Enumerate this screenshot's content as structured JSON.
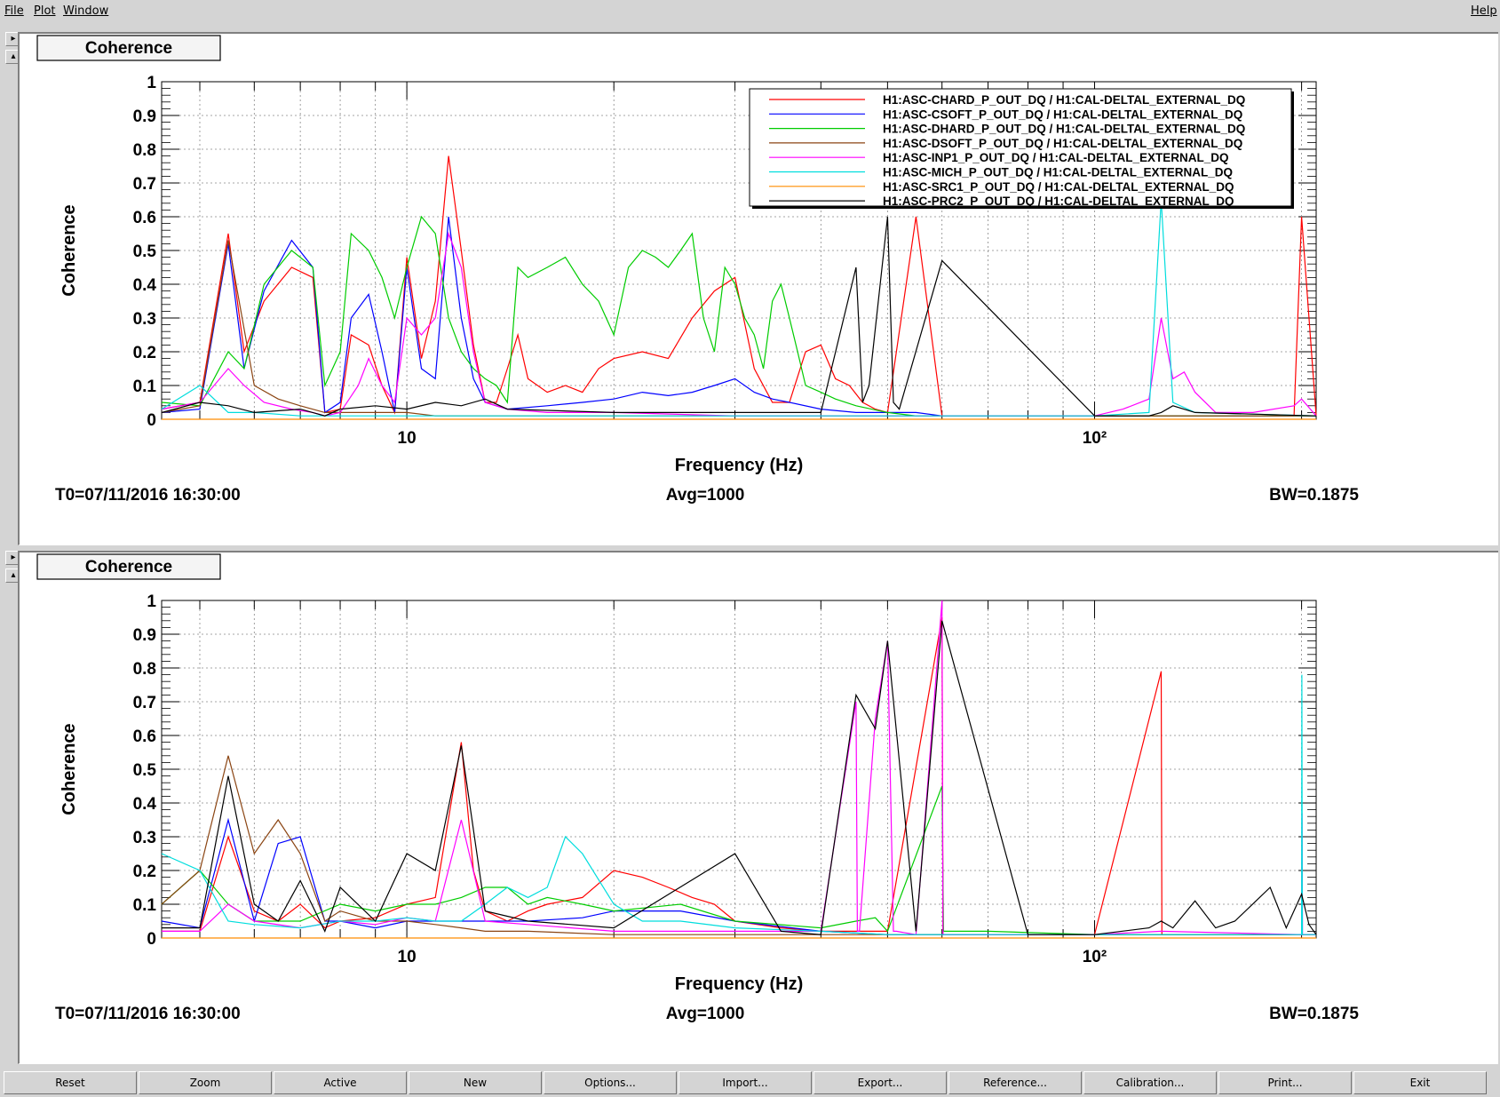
{
  "menu": {
    "file": "File",
    "plot": "Plot",
    "window": "Window",
    "help": "Help"
  },
  "side_arrows": {
    "right": "▸",
    "up": "▴"
  },
  "buttons": [
    "Reset",
    "Zoom",
    "Active",
    "New",
    "Options...",
    "Import...",
    "Export...",
    "Reference...",
    "Calibration...",
    "Print...",
    "Exit"
  ],
  "colors": {
    "CHARD": "#ff0000",
    "CSOFT": "#0000ff",
    "DHARD": "#00cc00",
    "DSOFT": "#8b4513",
    "INP1": "#ff00ff",
    "MICH": "#00dddd",
    "SRC1": "#ff8c00",
    "PRC2": "#000000"
  },
  "chart_data": [
    {
      "type": "line",
      "panel_title": "Coherence",
      "xlabel": "Frequency (Hz)",
      "ylabel": "Coherence",
      "xscale": "log",
      "xlim": [
        4.4,
        210
      ],
      "ylim": [
        0,
        1
      ],
      "x_tick_labels": [
        "10",
        "10²"
      ],
      "y_tick_labels": [
        "0",
        "0.1",
        "0.2",
        "0.3",
        "0.4",
        "0.5",
        "0.6",
        "0.7",
        "0.8",
        "0.9",
        "1"
      ],
      "grid": true,
      "legend_position": "top-right",
      "footer": {
        "t0": "T0=07/11/2016 16:30:00",
        "avg": "Avg=1000",
        "bw": "BW=0.1875"
      },
      "series": [
        {
          "name": "H1:ASC-CHARD_P_OUT_DQ / H1:CAL-DELTAL_EXTERNAL_DQ",
          "key": "CHARD",
          "x": [
            4.4,
            5,
            5.5,
            5.8,
            6.2,
            6.8,
            7.3,
            7.6,
            8,
            8.3,
            8.8,
            9.2,
            9.6,
            10,
            10.5,
            11,
            11.5,
            12,
            12.5,
            13,
            13.5,
            14,
            14.5,
            15,
            16,
            17,
            18,
            19,
            20,
            22,
            24,
            26,
            28,
            30,
            32,
            34,
            36,
            38,
            40,
            42,
            44,
            46,
            48,
            50,
            55,
            60,
            70,
            80,
            100,
            120,
            150,
            195,
            200,
            210
          ],
          "y": [
            0.03,
            0.05,
            0.55,
            0.2,
            0.35,
            0.45,
            0.42,
            0.02,
            0.03,
            0.25,
            0.22,
            0.1,
            0.02,
            0.48,
            0.18,
            0.35,
            0.78,
            0.5,
            0.22,
            0.05,
            0.05,
            0.15,
            0.25,
            0.12,
            0.08,
            0.1,
            0.08,
            0.15,
            0.18,
            0.2,
            0.18,
            0.3,
            0.38,
            0.42,
            0.15,
            0.05,
            0.05,
            0.2,
            0.22,
            0.12,
            0.1,
            0.05,
            0.03,
            0.02,
            0.6,
            0.01,
            0.01,
            0.01,
            0.01,
            0.01,
            0.01,
            0.01,
            0.6,
            0.01
          ]
        },
        {
          "name": "H1:ASC-CSOFT_P_OUT_DQ / H1:CAL-DELTAL_EXTERNAL_DQ",
          "key": "CSOFT",
          "x": [
            4.4,
            5,
            5.5,
            5.8,
            6.2,
            6.8,
            7.3,
            7.6,
            8,
            8.3,
            8.8,
            9.2,
            9.6,
            10,
            10.5,
            11,
            11.5,
            12,
            12.5,
            13,
            14,
            16,
            18,
            20,
            22,
            24,
            26,
            28,
            30,
            32,
            34,
            36,
            40,
            45,
            50,
            55,
            60,
            80,
            100,
            150,
            210
          ],
          "y": [
            0.02,
            0.03,
            0.52,
            0.15,
            0.38,
            0.53,
            0.45,
            0.02,
            0.05,
            0.3,
            0.37,
            0.2,
            0.02,
            0.45,
            0.15,
            0.12,
            0.6,
            0.3,
            0.12,
            0.05,
            0.03,
            0.04,
            0.05,
            0.06,
            0.08,
            0.07,
            0.08,
            0.1,
            0.12,
            0.08,
            0.06,
            0.05,
            0.03,
            0.02,
            0.02,
            0.02,
            0.01,
            0.01,
            0.01,
            0.01,
            0.01
          ]
        },
        {
          "name": "H1:ASC-DHARD_P_OUT_DQ / H1:CAL-DELTAL_EXTERNAL_DQ",
          "key": "DHARD",
          "x": [
            4.4,
            5,
            5.5,
            5.8,
            6.2,
            6.8,
            7.3,
            7.6,
            8,
            8.3,
            8.8,
            9.2,
            9.6,
            10,
            10.5,
            11,
            11.5,
            12,
            12.5,
            13,
            13.5,
            14,
            14.5,
            15,
            16,
            17,
            18,
            19,
            20,
            21,
            22,
            23,
            24,
            25,
            26,
            27,
            28,
            29,
            30,
            31,
            32,
            33,
            34,
            35,
            36,
            37,
            38,
            40,
            42,
            45,
            50,
            55,
            60,
            70,
            100,
            150,
            210
          ],
          "y": [
            0.05,
            0.04,
            0.2,
            0.15,
            0.4,
            0.5,
            0.45,
            0.1,
            0.2,
            0.55,
            0.5,
            0.42,
            0.3,
            0.45,
            0.6,
            0.55,
            0.3,
            0.2,
            0.15,
            0.12,
            0.1,
            0.05,
            0.45,
            0.42,
            0.45,
            0.48,
            0.4,
            0.35,
            0.25,
            0.45,
            0.5,
            0.48,
            0.45,
            0.5,
            0.55,
            0.3,
            0.2,
            0.45,
            0.4,
            0.3,
            0.25,
            0.15,
            0.35,
            0.4,
            0.3,
            0.2,
            0.1,
            0.08,
            0.06,
            0.04,
            0.02,
            0.01,
            0.01,
            0.01,
            0.01,
            0.01,
            0.01
          ]
        },
        {
          "name": "H1:ASC-DSOFT_P_OUT_DQ / H1:CAL-DELTAL_EXTERNAL_DQ",
          "key": "DSOFT",
          "x": [
            4.4,
            5,
            5.5,
            6,
            6.5,
            7,
            7.6,
            8,
            9,
            10,
            11,
            12,
            13,
            15,
            20,
            30,
            50,
            100,
            210
          ],
          "y": [
            0.02,
            0.04,
            0.53,
            0.1,
            0.06,
            0.04,
            0.02,
            0.02,
            0.02,
            0.02,
            0.01,
            0.01,
            0.01,
            0.01,
            0.01,
            0.01,
            0.01,
            0.01,
            0.01
          ]
        },
        {
          "name": "H1:ASC-INP1_P_OUT_DQ / H1:CAL-DELTAL_EXTERNAL_DQ",
          "key": "INP1",
          "x": [
            4.4,
            5,
            5.5,
            5.8,
            6.2,
            6.8,
            7.3,
            7.6,
            8,
            8.5,
            8.8,
            9.2,
            9.6,
            10,
            10.5,
            11,
            11.5,
            12,
            12.5,
            13,
            14,
            16,
            18,
            20,
            30,
            50,
            80,
            100,
            110,
            120,
            125,
            130,
            135,
            140,
            150,
            170,
            195,
            200,
            210
          ],
          "y": [
            0.03,
            0.05,
            0.15,
            0.1,
            0.05,
            0.03,
            0.02,
            0.01,
            0.02,
            0.1,
            0.18,
            0.1,
            0.05,
            0.3,
            0.25,
            0.3,
            0.55,
            0.45,
            0.2,
            0.05,
            0.03,
            0.02,
            0.02,
            0.02,
            0.01,
            0.01,
            0.01,
            0.01,
            0.03,
            0.06,
            0.3,
            0.12,
            0.14,
            0.08,
            0.02,
            0.02,
            0.04,
            0.06,
            0.01
          ]
        },
        {
          "name": "H1:ASC-MICH_P_OUT_DQ / H1:CAL-DELTAL_EXTERNAL_DQ",
          "key": "MICH",
          "x": [
            4.4,
            5,
            5.5,
            6,
            7,
            8,
            10,
            15,
            20,
            30,
            50,
            100,
            120,
            125,
            130,
            140,
            210
          ],
          "y": [
            0.03,
            0.1,
            0.02,
            0.02,
            0.01,
            0.01,
            0.01,
            0.01,
            0.01,
            0.01,
            0.01,
            0.01,
            0.02,
            0.65,
            0.05,
            0.02,
            0.01
          ]
        },
        {
          "name": "H1:ASC-SRC1_P_OUT_DQ / H1:CAL-DELTAL_EXTERNAL_DQ",
          "key": "SRC1",
          "x": [
            4.4,
            10,
            50,
            210
          ],
          "y": [
            0,
            0,
            0,
            0
          ]
        },
        {
          "name": "H1:ASC-PRC2_P_OUT_DQ / H1:CAL-DELTAL_EXTERNAL_DQ",
          "key": "PRC2",
          "x": [
            4.4,
            5,
            5.5,
            6,
            7,
            7.6,
            8,
            9,
            10,
            11,
            12,
            13,
            14,
            20,
            30,
            40,
            45,
            46,
            47,
            50,
            51,
            52,
            60,
            100,
            120,
            125,
            130,
            140,
            210
          ],
          "y": [
            0.02,
            0.05,
            0.04,
            0.02,
            0.03,
            0.01,
            0.03,
            0.04,
            0.03,
            0.05,
            0.04,
            0.06,
            0.03,
            0.02,
            0.02,
            0.02,
            0.45,
            0.05,
            0.1,
            0.6,
            0.05,
            0.03,
            0.47,
            0.01,
            0.01,
            0.02,
            0.04,
            0.02,
            0.01
          ]
        }
      ]
    },
    {
      "type": "line",
      "panel_title": "Coherence",
      "xlabel": "Frequency (Hz)",
      "ylabel": "Coherence",
      "xscale": "log",
      "xlim": [
        4.4,
        210
      ],
      "ylim": [
        0,
        1
      ],
      "x_tick_labels": [
        "10",
        "10²"
      ],
      "y_tick_labels": [
        "0",
        "0.1",
        "0.2",
        "0.3",
        "0.4",
        "0.5",
        "0.6",
        "0.7",
        "0.8",
        "0.9",
        "1"
      ],
      "grid": true,
      "footer": {
        "t0": "T0=07/11/2016 16:30:00",
        "avg": "Avg=1000",
        "bw": "BW=0.1875"
      },
      "series": [
        {
          "key": "CHARD",
          "x": [
            4.4,
            5,
            5.5,
            6,
            6.5,
            7,
            7.6,
            8,
            9,
            10,
            11,
            12,
            12.5,
            13,
            14,
            15,
            16,
            18,
            20,
            22,
            24,
            26,
            28,
            30,
            35,
            40,
            50,
            60,
            60.2,
            70,
            100,
            125,
            125.3,
            140,
            200,
            210
          ],
          "y": [
            0.02,
            0.02,
            0.3,
            0.08,
            0.05,
            0.1,
            0.03,
            0.05,
            0.06,
            0.1,
            0.12,
            0.58,
            0.2,
            0.08,
            0.05,
            0.08,
            0.1,
            0.12,
            0.2,
            0.18,
            0.15,
            0.12,
            0.1,
            0.05,
            0.03,
            0.02,
            0.02,
            0.95,
            0.01,
            0.01,
            0.01,
            0.79,
            0.01,
            0.01,
            0.01,
            0.01
          ]
        },
        {
          "key": "CSOFT",
          "x": [
            4.4,
            5,
            5.5,
            6,
            6.5,
            7,
            7.6,
            8,
            9,
            10,
            11,
            12,
            13,
            15,
            18,
            20,
            25,
            30,
            40,
            50,
            100,
            210
          ],
          "y": [
            0.05,
            0.03,
            0.35,
            0.05,
            0.28,
            0.3,
            0.05,
            0.05,
            0.03,
            0.05,
            0.05,
            0.05,
            0.05,
            0.05,
            0.06,
            0.08,
            0.08,
            0.05,
            0.02,
            0.01,
            0.01,
            0.01
          ]
        },
        {
          "key": "DHARD",
          "x": [
            4.4,
            5,
            5.5,
            6,
            7,
            8,
            9,
            10,
            11,
            12,
            13,
            14,
            15,
            16,
            18,
            20,
            25,
            30,
            40,
            45,
            48,
            50,
            60,
            60.3,
            70,
            100,
            210
          ],
          "y": [
            0.1,
            0.2,
            0.1,
            0.05,
            0.05,
            0.1,
            0.08,
            0.1,
            0.1,
            0.12,
            0.15,
            0.15,
            0.1,
            0.12,
            0.1,
            0.08,
            0.1,
            0.05,
            0.03,
            0.05,
            0.06,
            0.02,
            0.45,
            0.02,
            0.02,
            0.01,
            0.01
          ]
        },
        {
          "key": "DSOFT",
          "x": [
            4.4,
            5,
            5.5,
            6,
            6.5,
            7,
            7.6,
            8,
            9,
            10,
            11,
            12,
            13,
            15,
            20,
            30,
            50,
            100,
            210
          ],
          "y": [
            0.1,
            0.2,
            0.54,
            0.25,
            0.35,
            0.25,
            0.05,
            0.08,
            0.05,
            0.05,
            0.04,
            0.03,
            0.02,
            0.02,
            0.01,
            0.01,
            0.01,
            0.01,
            0.01
          ]
        },
        {
          "key": "INP1",
          "x": [
            4.4,
            5,
            5.5,
            6,
            7,
            8,
            9,
            10,
            11,
            12,
            13,
            15,
            20,
            30,
            40,
            45,
            45.2,
            45.5,
            48,
            50,
            51,
            51.5,
            55,
            60,
            60.2,
            60.5,
            100,
            125,
            200,
            200.3,
            200.6,
            210
          ],
          "y": [
            0.02,
            0.02,
            0.1,
            0.05,
            0.03,
            0.05,
            0.04,
            0.06,
            0.05,
            0.35,
            0.05,
            0.04,
            0.02,
            0.02,
            0.02,
            0.7,
            0.02,
            0.02,
            0.65,
            0.88,
            0.02,
            0.02,
            0.01,
            1.0,
            0.01,
            0.01,
            0.01,
            0.02,
            0.01,
            0.37,
            0.01,
            0.01
          ]
        },
        {
          "key": "MICH",
          "x": [
            4.4,
            5,
            5.5,
            6,
            7,
            8,
            9,
            10,
            11,
            12,
            13,
            14,
            15,
            16,
            17,
            18,
            20,
            22,
            25,
            30,
            40,
            50,
            100,
            200,
            200.2,
            200.5,
            210
          ],
          "y": [
            0.25,
            0.2,
            0.05,
            0.04,
            0.03,
            0.05,
            0.05,
            0.06,
            0.05,
            0.05,
            0.1,
            0.15,
            0.12,
            0.15,
            0.3,
            0.25,
            0.1,
            0.05,
            0.05,
            0.03,
            0.02,
            0.01,
            0.01,
            0.01,
            0.78,
            0.01,
            0.01
          ]
        },
        {
          "key": "SRC1",
          "x": [
            4.4,
            10,
            50,
            210
          ],
          "y": [
            0,
            0,
            0,
            0
          ]
        },
        {
          "key": "PRC2",
          "x": [
            4.4,
            5,
            5.5,
            6,
            6.5,
            7,
            7.6,
            8,
            9,
            10,
            11,
            12,
            13,
            15,
            20,
            30,
            35,
            40,
            45,
            48,
            50,
            55,
            60,
            80,
            100,
            120,
            125,
            130,
            140,
            150,
            160,
            180,
            190,
            200,
            205,
            210
          ],
          "y": [
            0.03,
            0.03,
            0.48,
            0.1,
            0.05,
            0.17,
            0.02,
            0.15,
            0.05,
            0.25,
            0.2,
            0.57,
            0.08,
            0.05,
            0.03,
            0.25,
            0.02,
            0.01,
            0.72,
            0.62,
            0.88,
            0.02,
            0.94,
            0.01,
            0.01,
            0.03,
            0.05,
            0.03,
            0.11,
            0.03,
            0.05,
            0.15,
            0.03,
            0.13,
            0.04,
            0.01
          ]
        }
      ]
    }
  ]
}
